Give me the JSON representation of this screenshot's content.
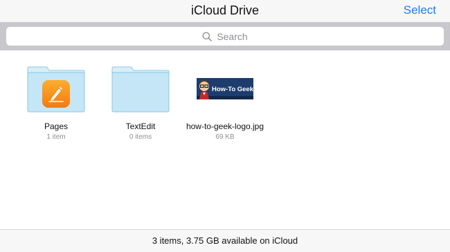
{
  "header": {
    "title": "iCloud Drive",
    "select_label": "Select"
  },
  "search": {
    "placeholder": "Search"
  },
  "files": [
    {
      "name": "Pages",
      "meta": "1 item",
      "kind": "folder",
      "icon": "pages-app-icon"
    },
    {
      "name": "TextEdit",
      "meta": "0 items",
      "kind": "folder",
      "icon": "folder-icon"
    },
    {
      "name": "how-to-geek-logo.jpg",
      "meta": "69 KB",
      "kind": "image",
      "icon": "image-thumbnail",
      "thumbnail_text": "How-To Geek"
    }
  ],
  "footer": {
    "status": "3 items, 3.75 GB available on iCloud"
  },
  "colors": {
    "accent": "#1a7cf4",
    "folder_fill": "#c4e6f6",
    "folder_stroke": "#8cc6e6",
    "pages_orange": "#f7931e",
    "thumbnail_blue": "#1c3d6e"
  }
}
